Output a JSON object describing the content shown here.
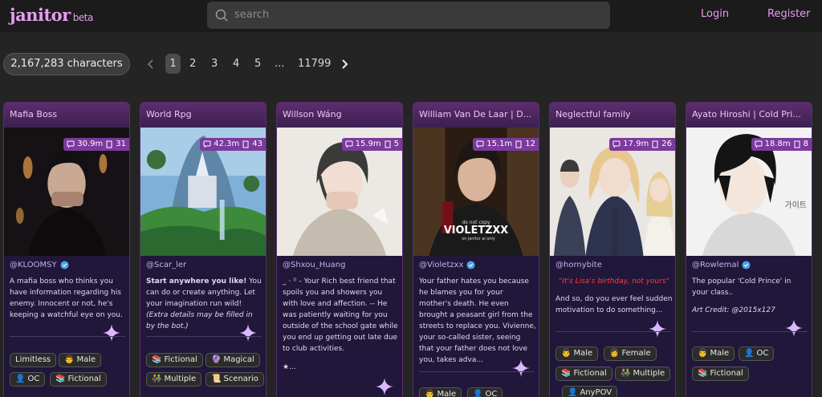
{
  "header": {
    "logo": "janitor",
    "logo_tag": "beta",
    "search_placeholder": "search",
    "login": "Login",
    "register": "Register"
  },
  "count": "2,167,283 characters",
  "pagination": {
    "pages": [
      "1",
      "2",
      "3",
      "4",
      "5",
      "...",
      "11799"
    ],
    "current": "1"
  },
  "cards": [
    {
      "title": "Mafia Boss",
      "tokens": "30.9m",
      "chats": "31",
      "creator": "@KLOOMSY",
      "verified": true,
      "desc": "A mafia boss who thinks you have information regarding his enemy. Innocent or not, he's keeping a watchful eye on you.",
      "tags": [
        "Limitless",
        "Male",
        "OC",
        "Fictional"
      ]
    },
    {
      "title": "World Rpg",
      "tokens": "42.3m",
      "chats": "43",
      "creator": "@Scar_ler",
      "verified": false,
      "desc_bold": "Start anywhere you like!",
      "desc": " You can do or create anything. Let your imagination run wild! ",
      "desc_italic": "(Extra details may be filled in by the bot.)",
      "tags": [
        "Fictional",
        "Magical",
        "Multiple",
        "Scenario"
      ]
    },
    {
      "title": "Willson Wáng",
      "tokens": "15.9m",
      "chats": "5",
      "creator": "@Shxou_Huang",
      "verified": false,
      "desc": "_ · ⁾⁾ - Your Rich best friend that spoils you and showers you with love and affection. -- He was patiently waiting for you outside of the school gate while you end up getting out late due to club activities.",
      "desc_tail": "★..."
    },
    {
      "title": "William Van De Laar | D...",
      "tokens": "15.1m",
      "chats": "12",
      "creator": "@Violetzxx",
      "verified": true,
      "watermark": "VIOLETZXX",
      "watermark_top": "do not copy",
      "watermark_bottom": "on janitor ai only",
      "desc": "Your father hates you because he blames you for your mother's death. He even brought a peasant girl from the streets to replace you. Vivienne, your so-called sister, seeing that your father does not love you, takes adva...",
      "tags": [
        "Male",
        "OC"
      ]
    },
    {
      "title": "Neglectful family",
      "tokens": "17.9m",
      "chats": "26",
      "creator": "@hornybite",
      "verified": false,
      "desc_red": "\"It's Lisa's birthday, not yours\"",
      "desc": "And so, do you ever feel sudden motivation to do something...",
      "tags": [
        "Male",
        "Female",
        "Fictional",
        "Multiple",
        "AnyPOV"
      ]
    },
    {
      "title": "Ayato Hiroshi | Cold Pri...",
      "tokens": "18.8m",
      "chats": "8",
      "creator": "@Rowlemal",
      "verified": true,
      "image_text": "가이트",
      "desc": "The popular 'Cold Prince' in your class..",
      "desc_italic": "Art Credit: @2015x127",
      "tags": [
        "Male",
        "OC",
        "Fictional"
      ]
    }
  ],
  "colors": {
    "accent": "#e79dee",
    "card_bg": "#20173a",
    "stats_bg": "#7b3a9d"
  }
}
